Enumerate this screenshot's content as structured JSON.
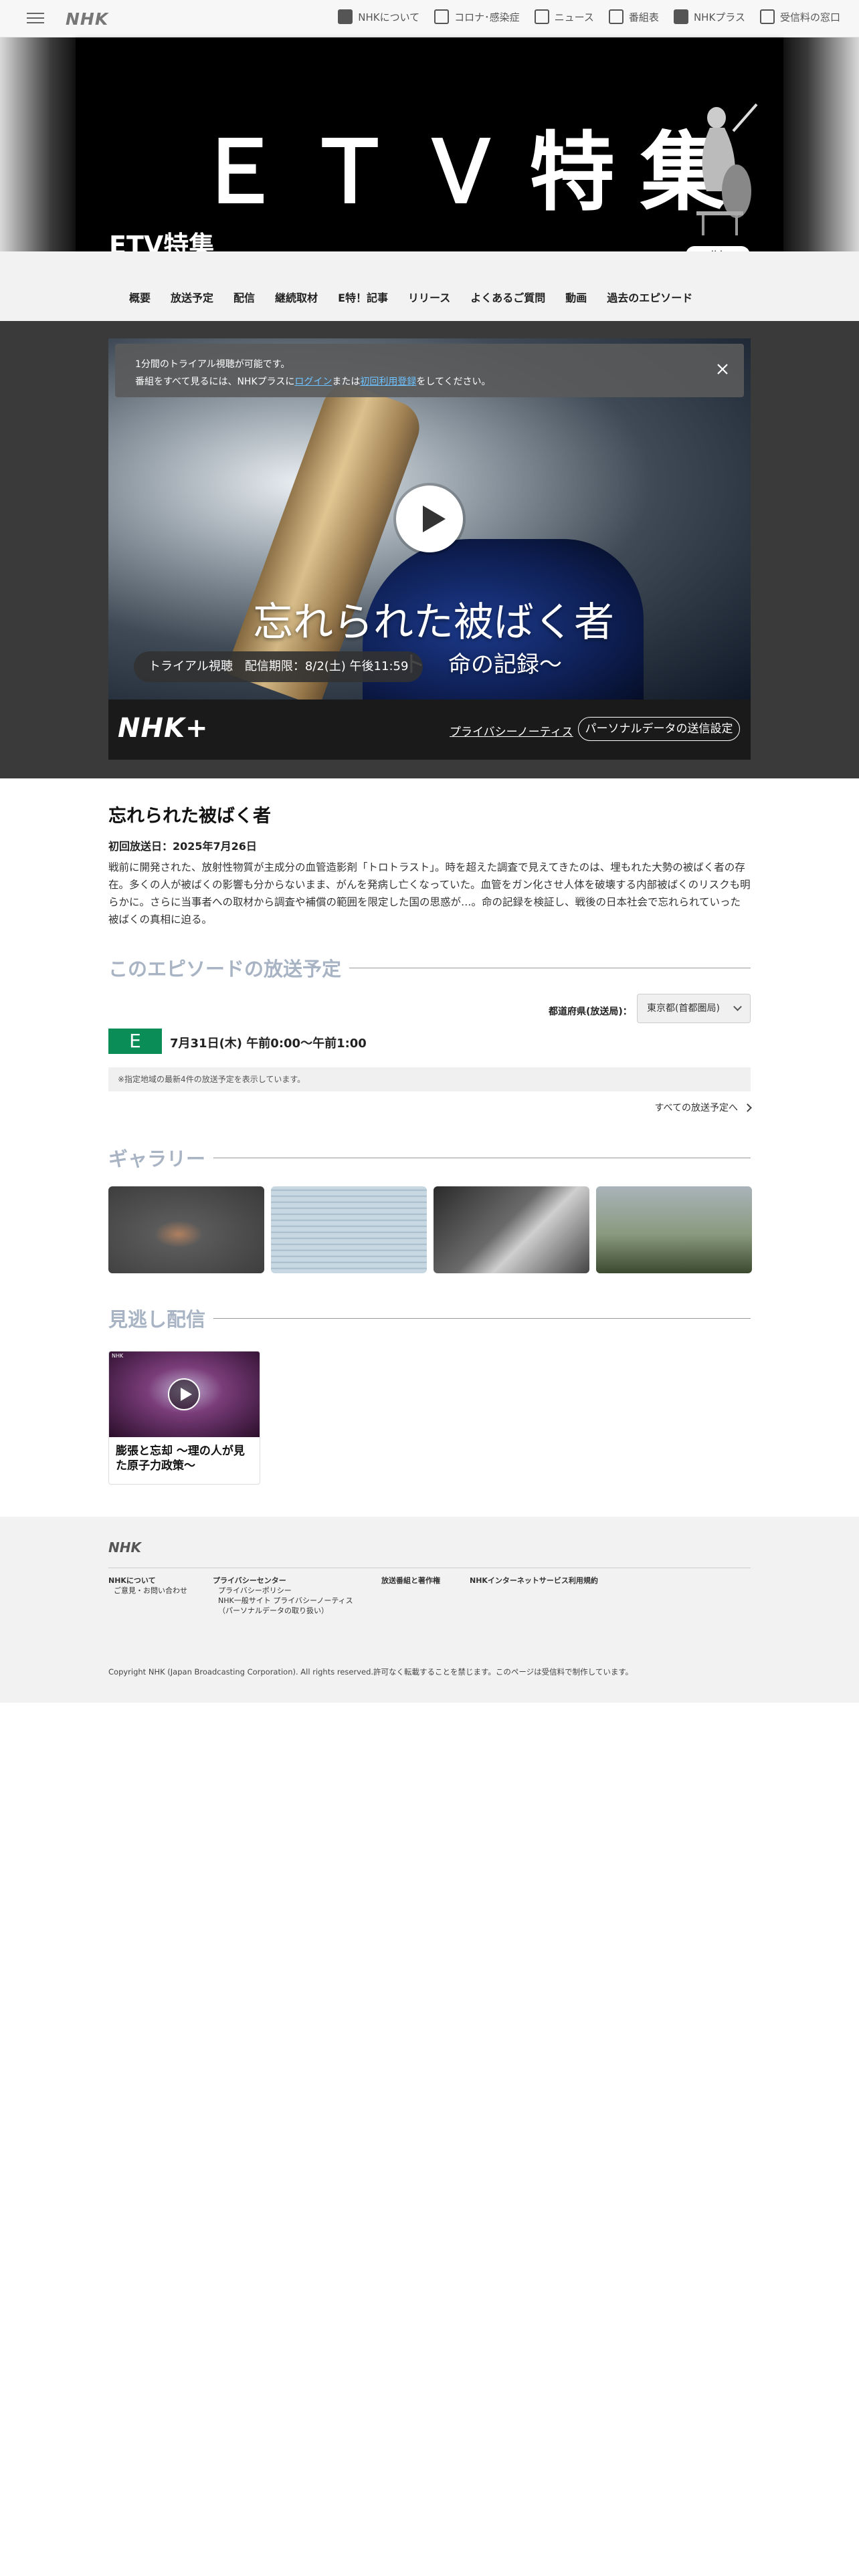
{
  "topbar": {
    "logo": "NHK",
    "links": [
      {
        "label": "NHKについて",
        "icon": "nhk-about-icon"
      },
      {
        "label": "コロナ･感染症",
        "icon": "virus-icon"
      },
      {
        "label": "ニュース",
        "icon": "news-icon"
      },
      {
        "label": "番組表",
        "icon": "schedule-grid-icon"
      },
      {
        "label": "NHKプラス",
        "icon": "nhkplus-icon"
      },
      {
        "label": "受信料の窓口",
        "icon": "receiving-fee-icon"
      }
    ]
  },
  "hero": {
    "banner_text": "ＥＴＶ特集",
    "title": "ETV特集",
    "share_label": "共有"
  },
  "subnav": {
    "items": [
      "概要",
      "放送予定",
      "配信",
      "継続取材",
      "E特！記事",
      "リリース",
      "よくあるご質問",
      "動画",
      "過去のエピソード"
    ]
  },
  "player": {
    "notice_line1": "1分間のトライアル視聴が可能です。",
    "notice_line2_pre": "番組をすべて見るには、NHKプラスに",
    "notice_login": "ログイン",
    "notice_mid": "または",
    "notice_register": "初回利用登録",
    "notice_post": "をしてください。",
    "video_title": "忘れられた被ばく者",
    "video_subtitle": "ト　命の記録～",
    "trial_label": "トライアル視聴　配信期限：8/2(土) 午後11:59",
    "logo": "NHK+",
    "privacy_link": "プライバシーノーティス",
    "personal_data_button": "パーソナルデータの送信設定"
  },
  "episode": {
    "title": "忘れられた被ばく者",
    "first_air": "初回放送日：2025年7月26日",
    "description": "戦前に開発された、放射性物質が主成分の血管造影剤「トロトラスト」。時を超えた調査で見えてきたのは、埋もれた大勢の被ばく者の存在。多くの人が被ばくの影響も分からないまま、がんを発病し亡くなっていた。血管をガン化させ人体を破壊する内部被ばくのリスクも明らかに。さらに当事者への取材から調査や補償の範囲を限定した国の思惑が…。命の記録を検証し、戦後の日本社会で忘れられていった被ばくの真相に迫る。"
  },
  "schedule": {
    "section_title": "このエピソードの放送予定",
    "pref_label": "都道府県(放送局)：",
    "pref_value": "東京都(首都圏局)",
    "channel": "E",
    "time": "7月31日(木) 午前0:00〜午前1:00",
    "note": "※指定地域の最新4件の放送予定を表示しています。",
    "all_link": "すべての放送予定へ"
  },
  "gallery": {
    "section_title": "ギャラリー"
  },
  "missed": {
    "section_title": "見逃し配信",
    "item_title": "膨張と忘却 ～理の人が見た原子力政策～",
    "item_tag": "NHK"
  },
  "footer": {
    "logo": "NHK",
    "col1_head": "NHKについて",
    "col1_sub": "ご意見・お問い合わせ",
    "col2_head": "プライバシーセンター",
    "col2_sub1": "プライバシーポリシー",
    "col2_sub2": "NHK一般サイト プライバシーノーティス",
    "col2_sub3": "（パーソナルデータの取り扱い）",
    "col3_head": "放送番組と著作権",
    "col4_head": "NHKインターネットサービス利用規約",
    "copyright": "Copyright NHK (Japan Broadcasting Corporation). All rights reserved.許可なく転載することを禁じます。このページは受信料で制作しています。"
  },
  "colors": {
    "etv_green": "#0a8d57",
    "section_title": "#a8b4c4",
    "link_blue": "#6ec2ff"
  }
}
